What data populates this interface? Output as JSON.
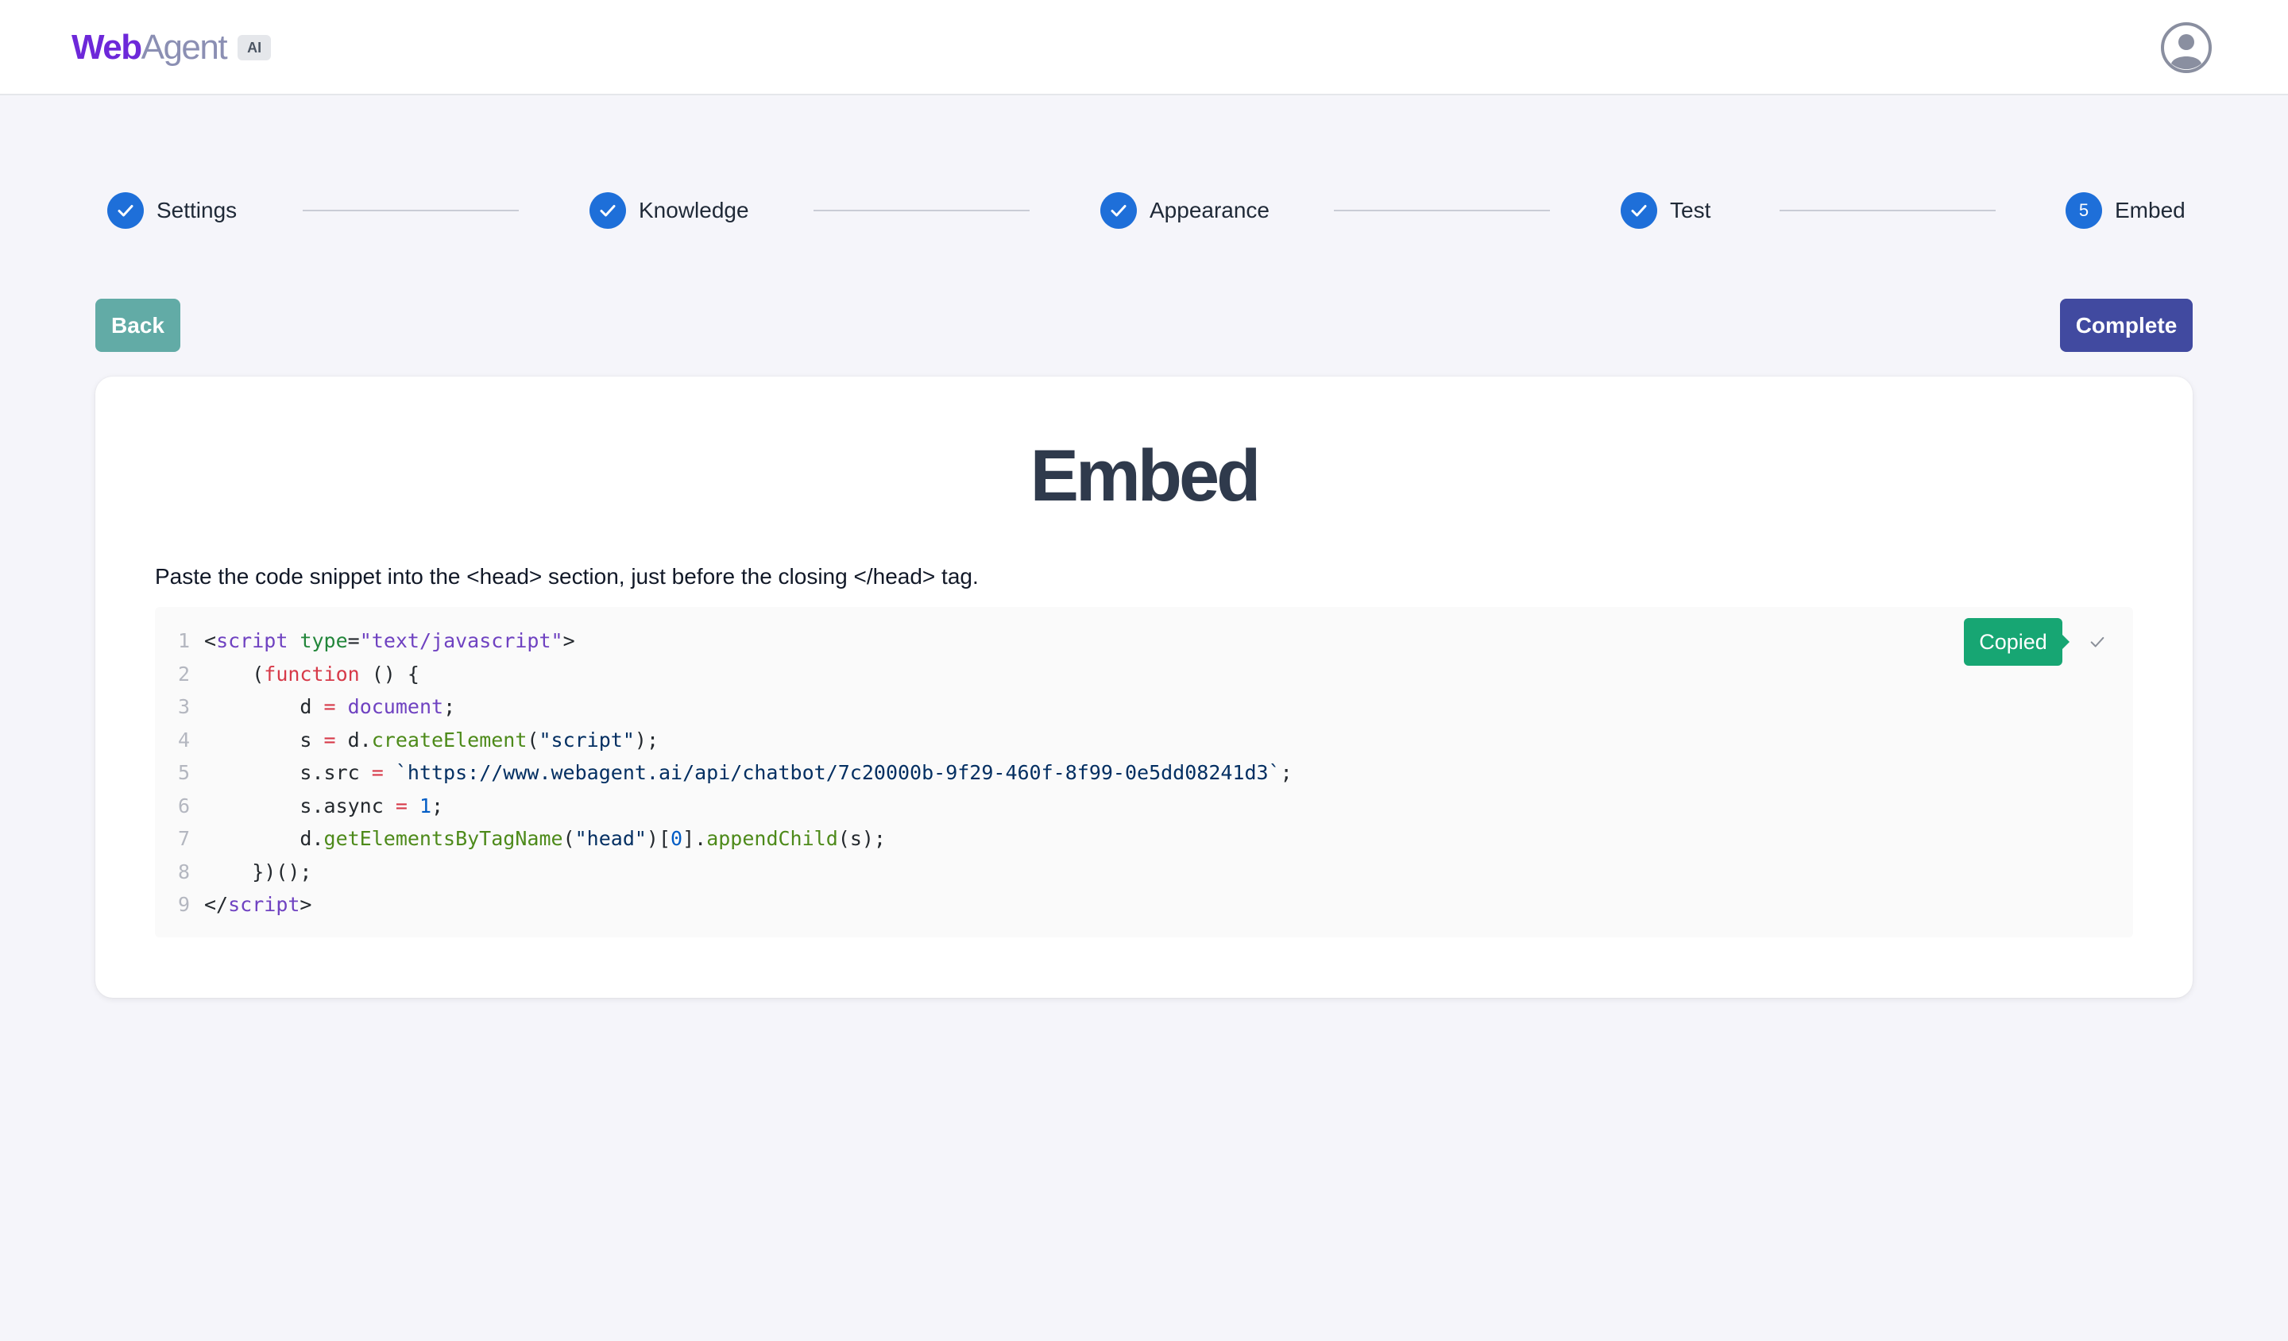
{
  "header": {
    "logo_web": "Web",
    "logo_agent": "Agent",
    "logo_badge": "AI",
    "avatar_icon": "user-circle-icon"
  },
  "stepper": {
    "steps": [
      {
        "label": "Settings",
        "status": "complete"
      },
      {
        "label": "Knowledge",
        "status": "complete"
      },
      {
        "label": "Appearance",
        "status": "complete"
      },
      {
        "label": "Test",
        "status": "complete"
      },
      {
        "label": "Embed",
        "status": "active",
        "number": "5"
      }
    ]
  },
  "actions": {
    "back_label": "Back",
    "complete_label": "Complete"
  },
  "card": {
    "title": "Embed",
    "instructions": "Paste the code snippet into the <head> section, just before the closing </head> tag."
  },
  "code": {
    "line_numbers": [
      "1",
      "2",
      "3",
      "4",
      "5",
      "6",
      "7",
      "8",
      "9"
    ],
    "lines": [
      [
        {
          "t": "<",
          "c": "plain"
        },
        {
          "t": "script",
          "c": "var"
        },
        {
          "t": " ",
          "c": "plain"
        },
        {
          "t": "type",
          "c": "tag"
        },
        {
          "t": "=",
          "c": "plain"
        },
        {
          "t": "\"text/javascript\"",
          "c": "var"
        },
        {
          "t": ">",
          "c": "plain"
        }
      ],
      [
        {
          "t": "    (",
          "c": "plain"
        },
        {
          "t": "function",
          "c": "kw"
        },
        {
          "t": " () {",
          "c": "plain"
        }
      ],
      [
        {
          "t": "        d ",
          "c": "plain"
        },
        {
          "t": "=",
          "c": "kw"
        },
        {
          "t": " ",
          "c": "plain"
        },
        {
          "t": "document",
          "c": "var"
        },
        {
          "t": ";",
          "c": "plain"
        }
      ],
      [
        {
          "t": "        s ",
          "c": "plain"
        },
        {
          "t": "=",
          "c": "kw"
        },
        {
          "t": " d.",
          "c": "plain"
        },
        {
          "t": "createElement",
          "c": "fn"
        },
        {
          "t": "(",
          "c": "plain"
        },
        {
          "t": "\"script\"",
          "c": "str"
        },
        {
          "t": ");",
          "c": "plain"
        }
      ],
      [
        {
          "t": "        s.src ",
          "c": "plain"
        },
        {
          "t": "=",
          "c": "kw"
        },
        {
          "t": " ",
          "c": "plain"
        },
        {
          "t": "`https://www.webagent.ai/api/chatbot/7c20000b-9f29-460f-8f99-0e5dd08241d3`",
          "c": "str"
        },
        {
          "t": ";",
          "c": "plain"
        }
      ],
      [
        {
          "t": "        s.async ",
          "c": "plain"
        },
        {
          "t": "=",
          "c": "kw"
        },
        {
          "t": " ",
          "c": "plain"
        },
        {
          "t": "1",
          "c": "num"
        },
        {
          "t": ";",
          "c": "plain"
        }
      ],
      [
        {
          "t": "        d.",
          "c": "plain"
        },
        {
          "t": "getElementsByTagName",
          "c": "fn"
        },
        {
          "t": "(",
          "c": "plain"
        },
        {
          "t": "\"head\"",
          "c": "str"
        },
        {
          "t": ")[",
          "c": "plain"
        },
        {
          "t": "0",
          "c": "num"
        },
        {
          "t": "].",
          "c": "plain"
        },
        {
          "t": "appendChild",
          "c": "fn"
        },
        {
          "t": "(s);",
          "c": "plain"
        }
      ],
      [
        {
          "t": "    })();",
          "c": "plain"
        }
      ],
      [
        {
          "t": "</",
          "c": "plain"
        },
        {
          "t": "script",
          "c": "var"
        },
        {
          "t": ">",
          "c": "plain"
        }
      ]
    ],
    "copied_label": "Copied",
    "check_icon": "check-icon"
  },
  "colors": {
    "primary": "#1e6fd9",
    "back_button": "#62aba6",
    "complete_button": "#414aa0",
    "copied_badge": "#17a673"
  }
}
